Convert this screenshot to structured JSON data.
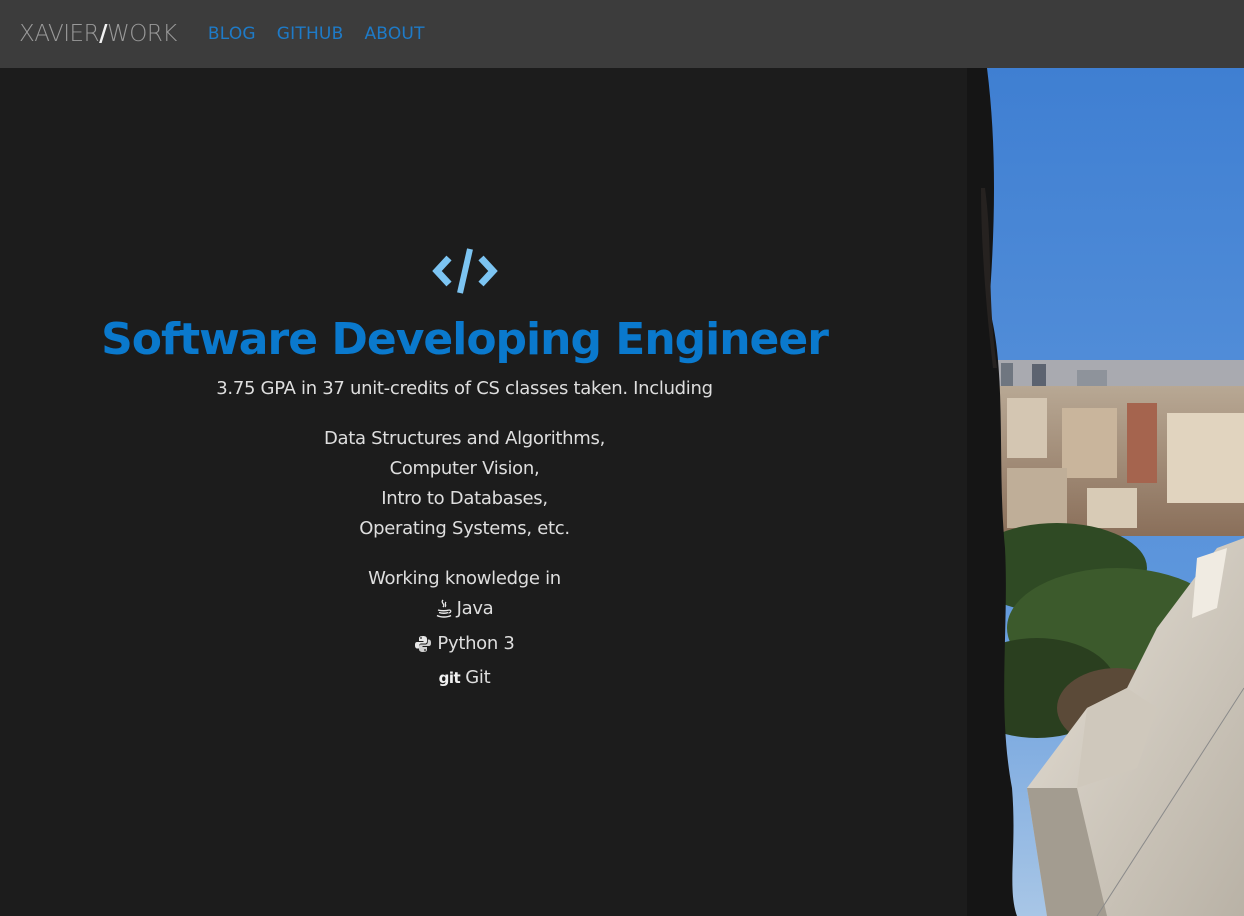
{
  "nav": {
    "brand_left": "XAVIER",
    "brand_slash": "/",
    "brand_right": "WORK",
    "links": [
      {
        "label": "BLOG"
      },
      {
        "label": "GITHUB"
      },
      {
        "label": "ABOUT"
      }
    ]
  },
  "hero": {
    "icon": "code-icon",
    "title": "Software Developing Engineer",
    "gpa_line": "3.75 GPA in 37 unit-credits of CS classes taken. Including",
    "classes": [
      "Data Structures and Algorithms,",
      "Computer Vision,",
      "Intro to Databases,",
      "Operating Systems, etc."
    ],
    "knowledge_heading": "Working knowledge in",
    "skills": [
      {
        "icon": "java-icon",
        "label": "Java"
      },
      {
        "icon": "python-icon",
        "label": "Python 3"
      },
      {
        "icon": "git-icon",
        "icon_text": "git",
        "label": "Git"
      }
    ]
  },
  "colors": {
    "navbar_bg": "#3c3c3c",
    "page_bg": "#1c1c1c",
    "accent_blue": "#0a79cd",
    "icon_light_blue": "#7cc4f2"
  }
}
